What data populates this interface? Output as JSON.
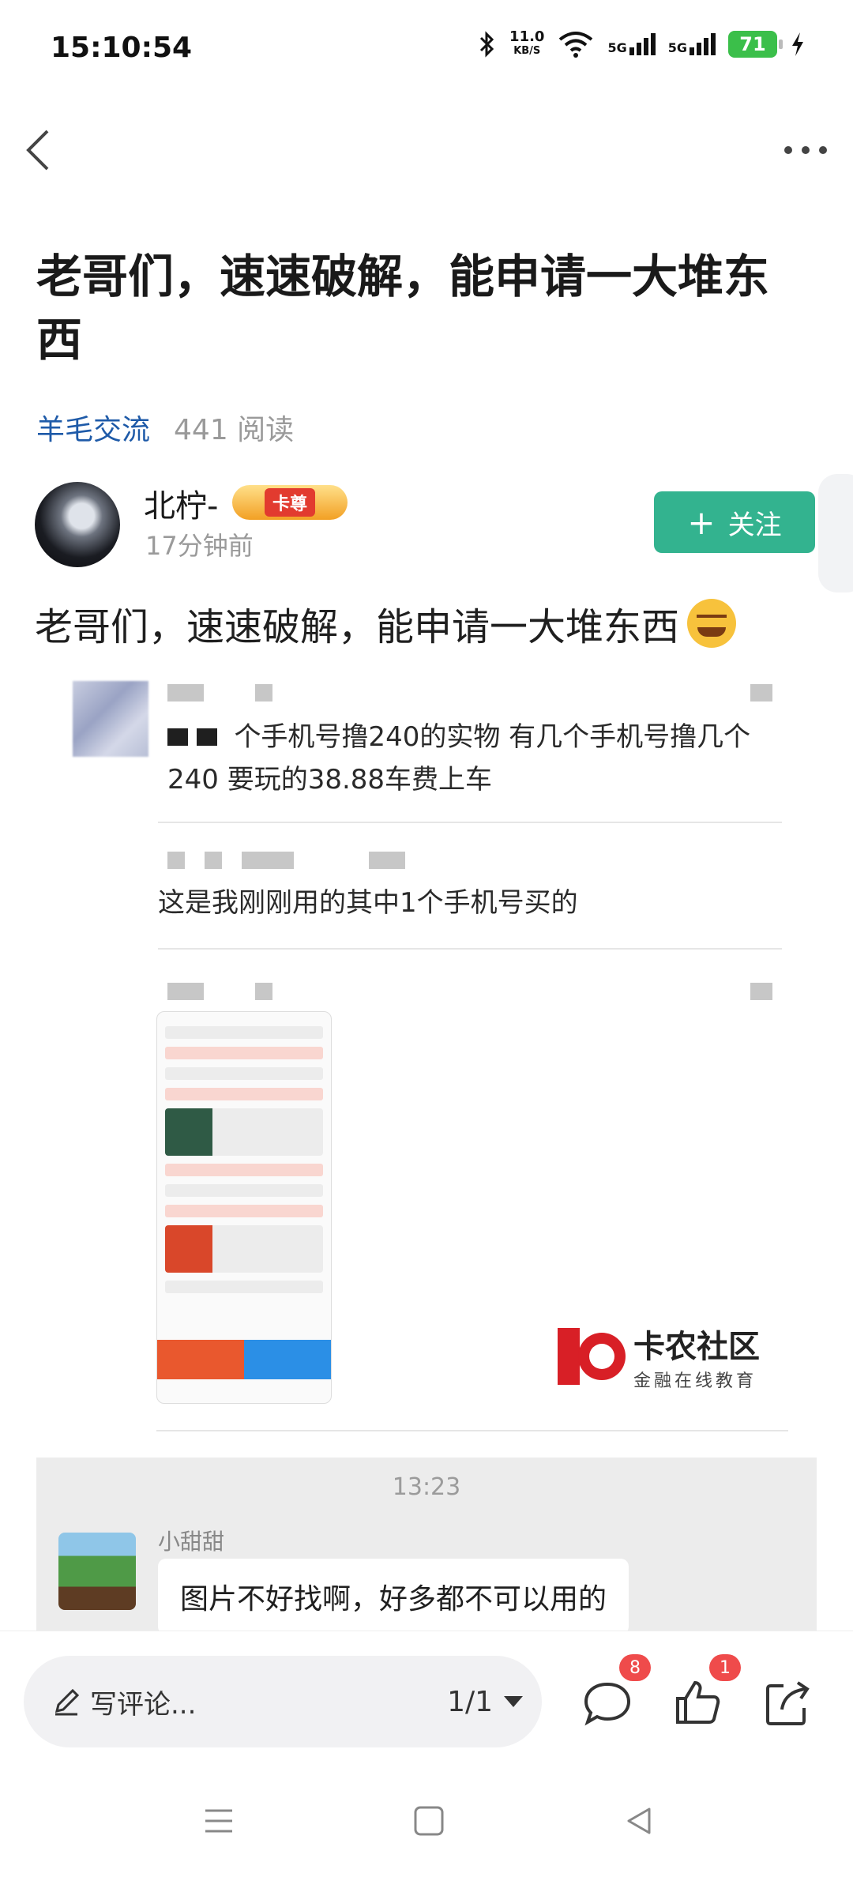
{
  "status_bar": {
    "time": "15:10:54",
    "net_speed": "11.0",
    "net_unit": "KB/S",
    "signal1": "5G",
    "signal2": "5G",
    "battery": "71"
  },
  "post": {
    "title": "老哥们，速速破解，能申请一大堆东西",
    "category": "羊毛交流",
    "reads": "441 阅读",
    "author": "北柠-",
    "author_badge": "卡尊",
    "time_ago": "17分钟前",
    "follow_label": "关注",
    "body": "老哥们，速速破解，能申请一大堆东西"
  },
  "embedded_chat": {
    "msg1": "个手机号撸240的实物  有几个手机号撸几个240   要玩的38.88车费上车",
    "msg2": "这是我刚刚用的其中1个手机号买的",
    "logo_title": "卡农社区",
    "logo_sub": "金融在线教育"
  },
  "chat": {
    "time": "13:23",
    "name": "小甜甜",
    "message": "图片不好找啊，好多都不可以用的"
  },
  "bottom_bar": {
    "comment_placeholder": "写评论...",
    "page_indicator": "1/1",
    "comments_count": "8",
    "likes_count": "1"
  }
}
